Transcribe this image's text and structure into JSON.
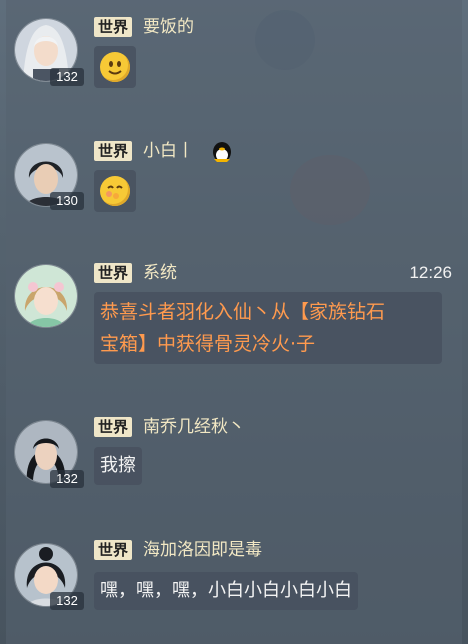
{
  "messages": [
    {
      "channel": "世界",
      "name": "要饭的",
      "level": "132",
      "content": "",
      "emoji": "smile-emoji",
      "time": ""
    },
    {
      "channel": "世界",
      "name": "小白丨",
      "level": "130",
      "content": "",
      "emoji": "shy-emoji",
      "time": "",
      "badge": "qq-penguin-icon"
    },
    {
      "channel": "世界",
      "name": "系统",
      "level": "",
      "content": "恭喜斗者羽化入仙丶从【家族钻石宝箱】中获得骨灵冷火·子",
      "emoji": "",
      "time": "12:26"
    },
    {
      "channel": "世界",
      "name": "南乔几经秋丶",
      "level": "132",
      "content": "我擦",
      "emoji": "",
      "time": ""
    },
    {
      "channel": "世界",
      "name": "海加洛因即是毒",
      "level": "132",
      "content": "嘿，嘿，嘿，小白小白小白小白",
      "emoji": "",
      "time": ""
    }
  ],
  "system_content_line1": "恭喜斗者羽化入仙丶从【家族钻石",
  "system_content_line2": "宝箱】中获得骨灵冷火·子",
  "colors": {
    "system_text": "#ff9a4e",
    "channel_tag": "#efe6c8",
    "name": "#f2e8c4"
  }
}
